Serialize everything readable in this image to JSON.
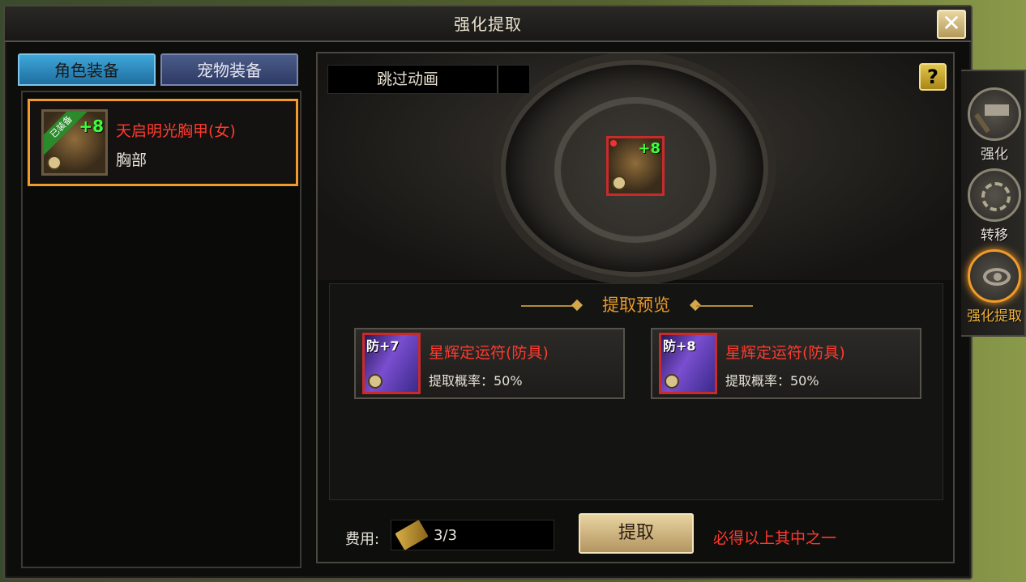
{
  "window": {
    "title": "强化提取"
  },
  "left": {
    "tabs": [
      {
        "label": "角色装备",
        "active": true
      },
      {
        "label": "宠物装备",
        "active": false
      }
    ],
    "items": [
      {
        "name": "天启明光胸甲(女)",
        "slot": "胸部",
        "level": "+8",
        "badge": "已装备"
      }
    ]
  },
  "content": {
    "skip_animation": "跳过动画",
    "center_item_level": "+8",
    "preview": {
      "title": "提取预览",
      "rewards": [
        {
          "tag": "防+7",
          "name": "星辉定运符(防具)",
          "rate": "提取概率：50%"
        },
        {
          "tag": "防+8",
          "name": "星辉定运符(防具)",
          "rate": "提取概率：50%"
        }
      ]
    },
    "cost_label": "费用:",
    "cost_value": "3/3",
    "extract_button": "提取",
    "guarantee_text": "必得以上其中之一"
  },
  "side_nav": [
    {
      "label": "强化",
      "icon": "hammer-icon",
      "active": false
    },
    {
      "label": "转移",
      "icon": "transfer-icon",
      "active": false
    },
    {
      "label": "强化提取",
      "icon": "extract-icon",
      "active": true
    }
  ],
  "colors": {
    "accent_orange": "#f29b2a",
    "red_text": "#ff3a2e",
    "tab_blue": "#3fa6d8"
  }
}
